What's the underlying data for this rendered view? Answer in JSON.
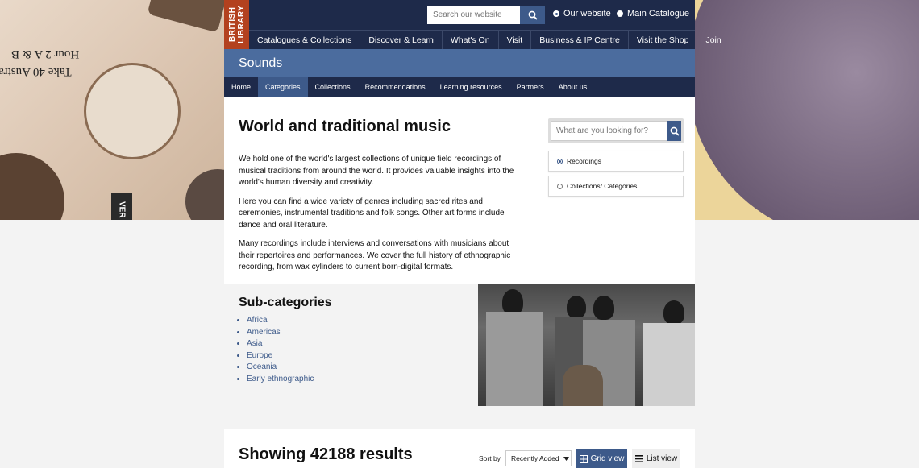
{
  "colors": {
    "navy": "#1e2a4a",
    "accent_blue": "#3d5a8a",
    "sounds_blue": "#4b6c9e",
    "logo_red": "#b3411f"
  },
  "banner": {
    "label_1": "Take 40 Austra",
    "label_2": "Hour 2 A & B",
    "label_3": "VER"
  },
  "logo": {
    "text": "BRITISH LIBRARY"
  },
  "site_search": {
    "placeholder": "Search our website",
    "icon": "search-icon"
  },
  "scope": {
    "option_1": "Our website",
    "option_2": "Main Catalogue",
    "selected": "Our website"
  },
  "main_nav": {
    "items": [
      "Catalogues & Collections",
      "Discover & Learn",
      "What's On",
      "Visit",
      "Business & IP Centre",
      "Visit the Shop",
      "Join"
    ]
  },
  "section_title": "Sounds",
  "sub_nav": {
    "items": [
      "Home",
      "Categories",
      "Collections",
      "Recommendations",
      "Learning resources",
      "Partners",
      "About us"
    ],
    "active": "Categories"
  },
  "intro": {
    "title": "World and traditional music",
    "paragraphs": [
      "We hold one of the world's largest collections of unique field recordings of musical traditions from around the world. It provides valuable insights into the world's human diversity and creativity.",
      "Here you can find a wide variety of genres including sacred rites and ceremonies, instrumental traditions and folk songs. Other art forms include dance and oral literature.",
      "Many recordings include interviews and conversations with musicians about their repertoires and performances. We cover the full history of ethnographic recording, from wax cylinders to current born-digital formats."
    ]
  },
  "aside": {
    "search_placeholder": "What are you looking for?",
    "option_recordings": "Recordings",
    "option_collections": "Collections/ Categories",
    "selected": "Recordings"
  },
  "subcategories": {
    "title": "Sub-categories",
    "items": [
      "Africa",
      "Americas",
      "Asia",
      "Europe",
      "Oceania",
      "Early ethnographic"
    ]
  },
  "results": {
    "title": "Showing 42188 results",
    "sort_label": "Sort by",
    "sort_value": "Recently Added",
    "grid_view": "Grid view",
    "list_view": "List view",
    "active_view": "Grid view"
  }
}
